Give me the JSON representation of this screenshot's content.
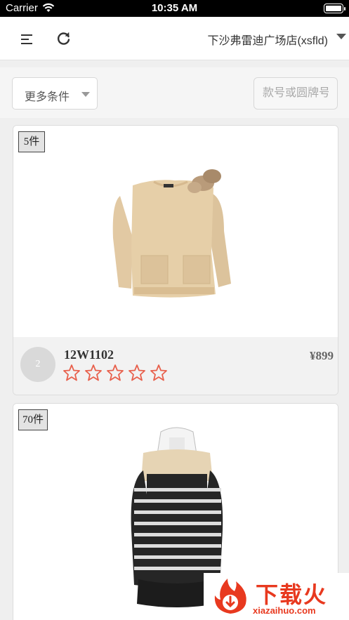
{
  "status_bar": {
    "carrier": "Carrier",
    "time": "10:35 AM"
  },
  "header": {
    "store_name": "下沙弗雷迪广场店(xsfld)"
  },
  "filters": {
    "more_label": "更多条件",
    "search_placeholder": "款号或圆牌号"
  },
  "products": [
    {
      "qty_badge": "5件",
      "avatar_text": "2",
      "code": "12W1102",
      "price": "¥899",
      "rating": 0,
      "max_rating": 5
    },
    {
      "qty_badge": "70件"
    }
  ],
  "watermark": {
    "title": "下载火",
    "url": "xiazaihuo.com"
  },
  "colors": {
    "star": "#e8604c",
    "accent": "#e8391f"
  },
  "icons": [
    "menu-icon",
    "refresh-icon",
    "dropdown-caret-icon",
    "star-icon",
    "wifi-icon",
    "battery-icon"
  ]
}
